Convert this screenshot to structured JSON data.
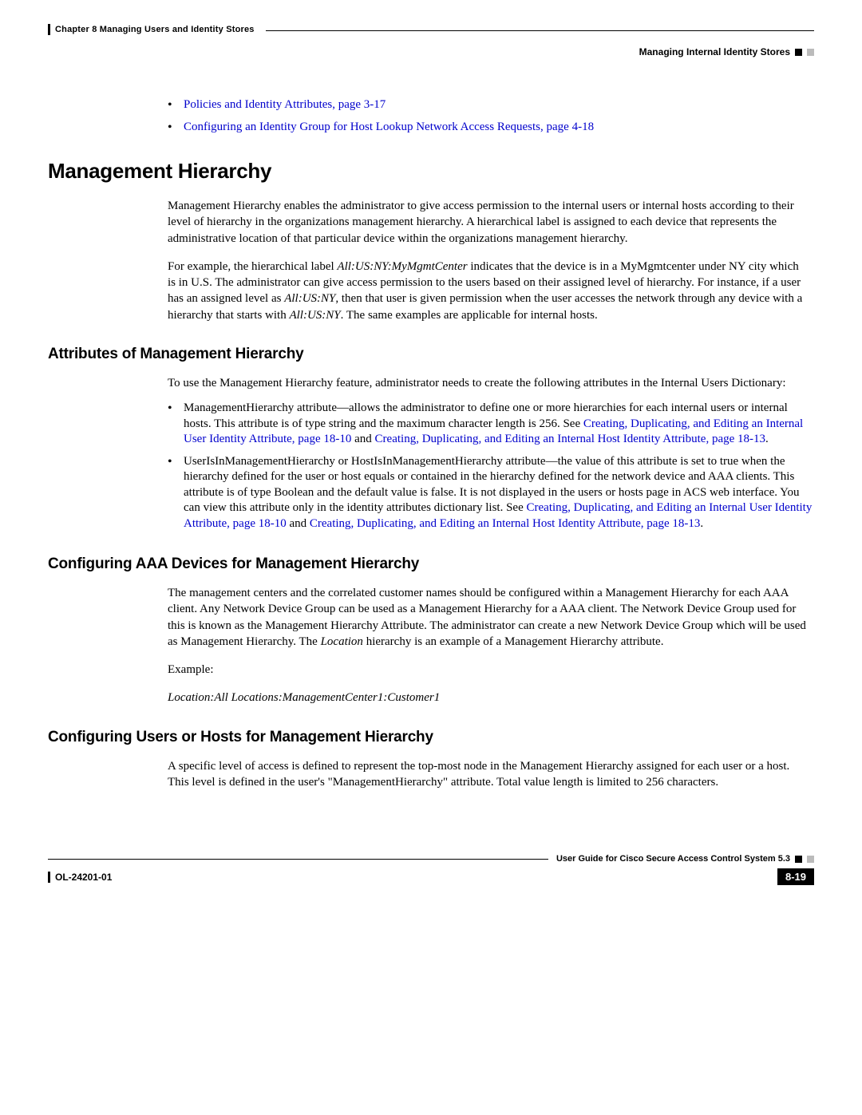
{
  "header": {
    "chapter": "Chapter 8    Managing Users and Identity Stores",
    "section": "Managing Internal Identity Stores"
  },
  "top_links": {
    "link1": "Policies and Identity Attributes, page 3-17",
    "link2": "Configuring an Identity Group for Host Lookup Network Access Requests, page 4-18"
  },
  "h1": "Management Hierarchy",
  "p1": "Management Hierarchy enables the administrator to give access permission to the internal users or internal hosts according to their level of hierarchy in the organizations management hierarchy. A hierarchical label is assigned to each device that represents the administrative location of that particular device within the organizations management hierarchy.",
  "p2a": "For example, the hierarchical label ",
  "p2b": "All:US:NY:MyMgmtCenter",
  "p2c": " indicates that the device is in a MyMgmtcenter under NY city which is in U.S. The administrator can give access permission to the users based on their assigned level of hierarchy. For instance, if a user has an assigned level as ",
  "p2d": "All:US:NY",
  "p2e": ", then that user is given permission when the user accesses the network through any device with a hierarchy that starts with ",
  "p2f": "All:US:NY",
  "p2g": ". The same examples are applicable for internal hosts.",
  "h2a": "Attributes of Management Hierarchy",
  "p3": "To use the Management Hierarchy feature, administrator needs to create the following attributes in the Internal Users Dictionary:",
  "bullet1a": "ManagementHierarchy attribute—allows the administrator to define one or more hierarchies for each internal users or internal hosts. This attribute is of type string and the maximum character length is 256. See ",
  "bullet1_link1": "Creating, Duplicating, and Editing an Internal User Identity Attribute, page 18-10",
  "bullet1b": " and ",
  "bullet1_link2": "Creating, Duplicating, and Editing an Internal Host Identity Attribute, page 18-13",
  "bullet1c": ".",
  "bullet2a": "UserIsInManagementHierarchy or HostIsInManagementHierarchy attribute—the value of this attribute is set to true when the hierarchy defined for the user or host equals or contained in the hierarchy defined for the network device and AAA clients. This attribute is of type Boolean and the default value is false. It is not displayed in the users or hosts page in ACS web interface. You can view this attribute only in the identity attributes dictionary list. See ",
  "bullet2_link1": "Creating, Duplicating, and Editing an Internal User Identity Attribute, page 18-10",
  "bullet2b": " and ",
  "bullet2_link2": "Creating, Duplicating, and Editing an Internal Host Identity Attribute, page 18-13",
  "bullet2c": ".",
  "h2b": "Configuring AAA Devices for Management Hierarchy",
  "p4a": "The management centers and the correlated customer names should be configured within a Management Hierarchy for each AAA client. Any Network Device Group can be used as a Management Hierarchy for a AAA client. The Network Device Group used for this is known as the Management Hierarchy Attribute. The administrator can create a new Network Device Group which will be used as Management Hierarchy. The ",
  "p4b": "Location",
  "p4c": " hierarchy is an example of a Management Hierarchy attribute.",
  "p5": "Example:",
  "p6": "Location:All Locations:ManagementCenter1:Customer1",
  "h2c": "Configuring Users or Hosts for Management Hierarchy",
  "p7": "A specific level of access is defined to represent the top-most node in the Management Hierarchy assigned for each user or a host. This level is defined in the user's \"ManagementHierarchy\" attribute. Total value length is limited to 256 characters.",
  "footer": {
    "guide": "User Guide for Cisco Secure Access Control System 5.3",
    "docid": "OL-24201-01",
    "pagenum": "8-19"
  }
}
